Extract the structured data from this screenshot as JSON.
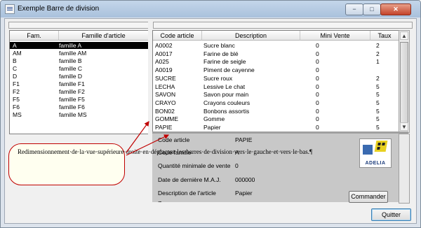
{
  "window": {
    "title": "Exemple Barre de division",
    "minimize_label": "−",
    "maximize_label": "□",
    "close_label": "✕"
  },
  "families_grid": {
    "columns": [
      "Fam.",
      "Famille d'article"
    ],
    "rows": [
      {
        "code": "A",
        "name": "famille A",
        "selected": true
      },
      {
        "code": "AM",
        "name": "famille AM"
      },
      {
        "code": "B",
        "name": "famille B"
      },
      {
        "code": "C",
        "name": "famille C"
      },
      {
        "code": "D",
        "name": "famille D"
      },
      {
        "code": "F1",
        "name": "famille F1"
      },
      {
        "code": "F2",
        "name": "famille F2"
      },
      {
        "code": "F5",
        "name": "famille F5"
      },
      {
        "code": "F6",
        "name": "famille F6"
      },
      {
        "code": "MS",
        "name": "famille MS"
      }
    ]
  },
  "articles_grid": {
    "columns": [
      "Code article",
      "Description",
      "Mini Vente",
      "Taux"
    ],
    "rows": [
      {
        "code": "A0002",
        "desc": "Sucre blanc",
        "mini": "0",
        "taux": "2"
      },
      {
        "code": "A0017",
        "desc": "Farine de blé",
        "mini": "0",
        "taux": "2"
      },
      {
        "code": "A025",
        "desc": "Farine de seigle",
        "mini": "0",
        "taux": "1"
      },
      {
        "code": "A0019",
        "desc": "Piment de cayenne",
        "mini": "0",
        "taux": ""
      },
      {
        "code": "SUCRE",
        "desc": "Sucre roux",
        "mini": "0",
        "taux": "2"
      },
      {
        "code": "LECHA",
        "desc": "Lessive Le chat",
        "mini": "0",
        "taux": "5"
      },
      {
        "code": "SAVON",
        "desc": "Savon pour main",
        "mini": "0",
        "taux": "5"
      },
      {
        "code": "CRAYO",
        "desc": "Crayons couleurs",
        "mini": "0",
        "taux": "5"
      },
      {
        "code": "BON02",
        "desc": "Bonbons assortis",
        "mini": "0",
        "taux": "5"
      },
      {
        "code": "GOMME",
        "desc": "Gomme",
        "mini": "0",
        "taux": "5"
      },
      {
        "code": "PAPIE",
        "desc": "Papier",
        "mini": "0",
        "taux": "5"
      }
    ]
  },
  "detail": {
    "fields": [
      {
        "label": "Code article",
        "value": "PAPIE"
      },
      {
        "label": "Code famille",
        "value": "A"
      },
      {
        "label": "Quantité minimale de vente",
        "value": "0"
      },
      {
        "label": "Date de dernière M.A.J.",
        "value": "000000"
      },
      {
        "label": "Description de l'article",
        "value": "Papier"
      },
      {
        "label": "Z...",
        "value": ""
      }
    ],
    "logo_text": "ADELIA",
    "commander_label": "Commander"
  },
  "quit_label": "Quitter",
  "callout": {
    "text": "Redimensionnement·de·la·vue·supérieure·droite·en·déplaçant·les·barres·de·division·vers·le·gauche·et·vers·le·bas.¶"
  },
  "scroll": {
    "up": "▲",
    "down": "▼"
  },
  "colors": {
    "callout_border": "#c00000",
    "selection": "#000000",
    "detail_bg": "#c8c8c8"
  }
}
